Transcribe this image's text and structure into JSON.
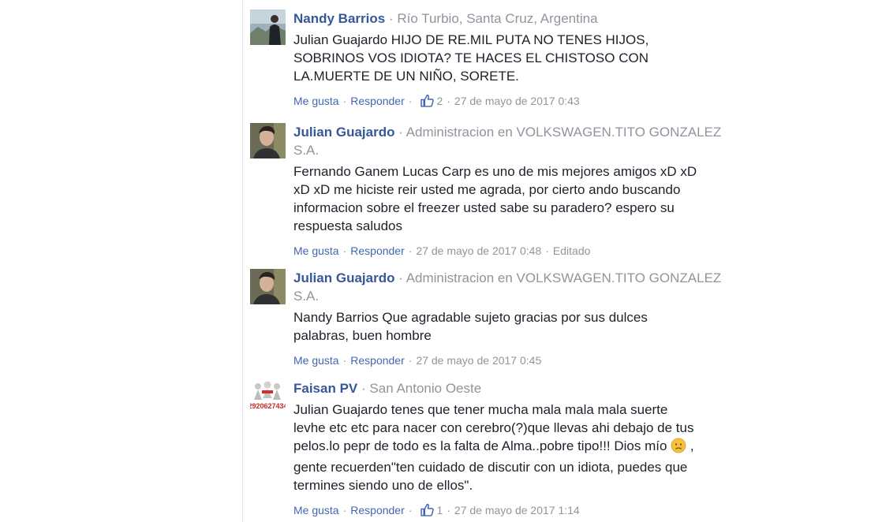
{
  "colors": {
    "author": "#365899",
    "link": "#4267b2",
    "meta": "#90949c",
    "text": "#1d2129"
  },
  "comments": [
    {
      "author": "Nandy Barrios",
      "sep": "·",
      "meta": "Río Turbio, Santa Cruz, Argentina",
      "lines": [
        "Julian Guajardo HIJO DE RE.MIL PUTA NO TENES HIJOS,",
        "SOBRINOS VOS IDIOTA? TE HACES EL CHISTOSO CON",
        "LA.MUERTE DE UN NIÑO, SORETE."
      ],
      "like": "Me gusta",
      "reply": "Responder",
      "dot": "·",
      "likes": "2",
      "time": "27 de mayo de 2017 0:43"
    },
    {
      "author": "Julian Guajardo",
      "sep": "·",
      "meta": "Administracion en VOLKSWAGEN.TITO GONZALEZ S.A.",
      "lines": [
        "Fernando Ganem Lucas Carp es uno de mis mejores amigos xD xD",
        "xD xD me hiciste reir usted me agrada, por cierto ando buscando",
        "informacion sobre el freezer usted sabe su paradero? espero su",
        "respuesta saludos"
      ],
      "like": "Me gusta",
      "reply": "Responder",
      "dot": "·",
      "time": "27 de mayo de 2017 0:48",
      "edited": "Editado"
    },
    {
      "author": "Julian Guajardo",
      "sep": "·",
      "meta": "Administracion en VOLKSWAGEN.TITO GONZALEZ S.A.",
      "lines": [
        "Nandy Barrios Que agradable sujeto gracias por sus dulces",
        "palabras, buen hombre"
      ],
      "like": "Me gusta",
      "reply": "Responder",
      "dot": "·",
      "time": "27 de mayo de 2017 0:45"
    },
    {
      "author": "Faisan PV",
      "sep": "·",
      "meta": "San Antonio Oeste",
      "avatar_text": "2920627434",
      "lines": [
        "Julian Guajardo tenes que tener mucha mala mala mala suerte",
        "levhe etc etc para nacer con cerebro(?)que llevas ahi debajo de tus",
        "pelos.lo pepr de todo es la falta de Alma..pobre tipo!!! Dios mío",
        "gente recuerden\"ten cuidado de discutir con un idiota, puedes que",
        "termines siendo uno de ellos\"."
      ],
      "line3_suffix": ",",
      "like": "Me gusta",
      "reply": "Responder",
      "dot": "·",
      "likes": "1",
      "time": "27 de mayo de 2017 1:14"
    }
  ]
}
